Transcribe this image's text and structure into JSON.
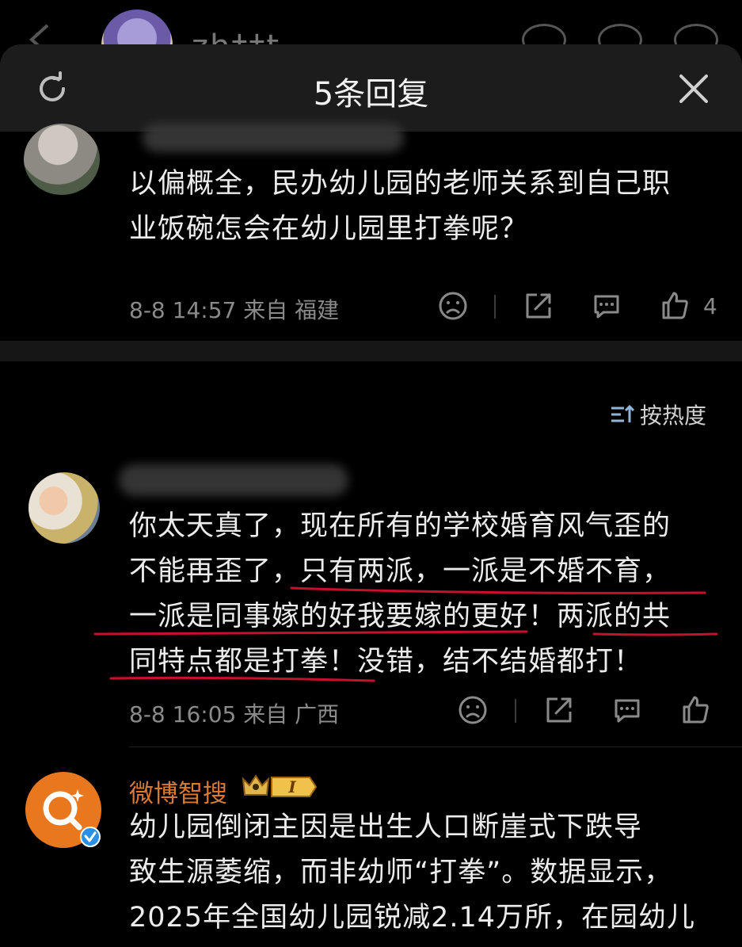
{
  "background_page": {
    "username_partial": "zh††t"
  },
  "panel": {
    "title": "5条回复"
  },
  "comment_top": {
    "text_line1": "以偏概全，民办幼儿园的老师关系到自己职",
    "text_line2": "业饭碗怎会在幼儿园里打拳呢？",
    "meta": "8-8 14:57  来自 福建",
    "like_count": "4"
  },
  "sort": {
    "label": "按热度"
  },
  "reply_1": {
    "text_line1": "你太天真了，现在所有的学校婚育风气歪的",
    "text_line2": "不能再歪了，只有两派，一派是不婚不育，",
    "text_line3": "一派是同事嫁的好我要嫁的更好！两派的共",
    "text_line4": "同特点都是打拳！没错，结不结婚都打！",
    "meta": "8-8 16:05  来自 广西"
  },
  "reply_2": {
    "name": "微博智搜",
    "badge_level": "I",
    "text_line1": "幼儿园倒闭主因是出生人口断崖式下跌导",
    "text_line2": "致生源萎缩，而非幼师“打拳”。数据显示，",
    "text_line3": "2025年全国幼儿园锐减2.14万所，在园幼儿"
  },
  "colors": {
    "background": "#000000",
    "panel_header": "#1c1c1c",
    "bot_name": "#d97a34",
    "bot_avatar": "#e8771e",
    "annotation_red": "#c8102e",
    "verified_blue": "#2b8fe6"
  },
  "icons": [
    "refresh-icon",
    "close-icon",
    "dislike-face-icon",
    "share-icon",
    "comment-icon",
    "thumb-up-icon",
    "sort-icon",
    "verified-icon",
    "crown-badge-icon"
  ]
}
